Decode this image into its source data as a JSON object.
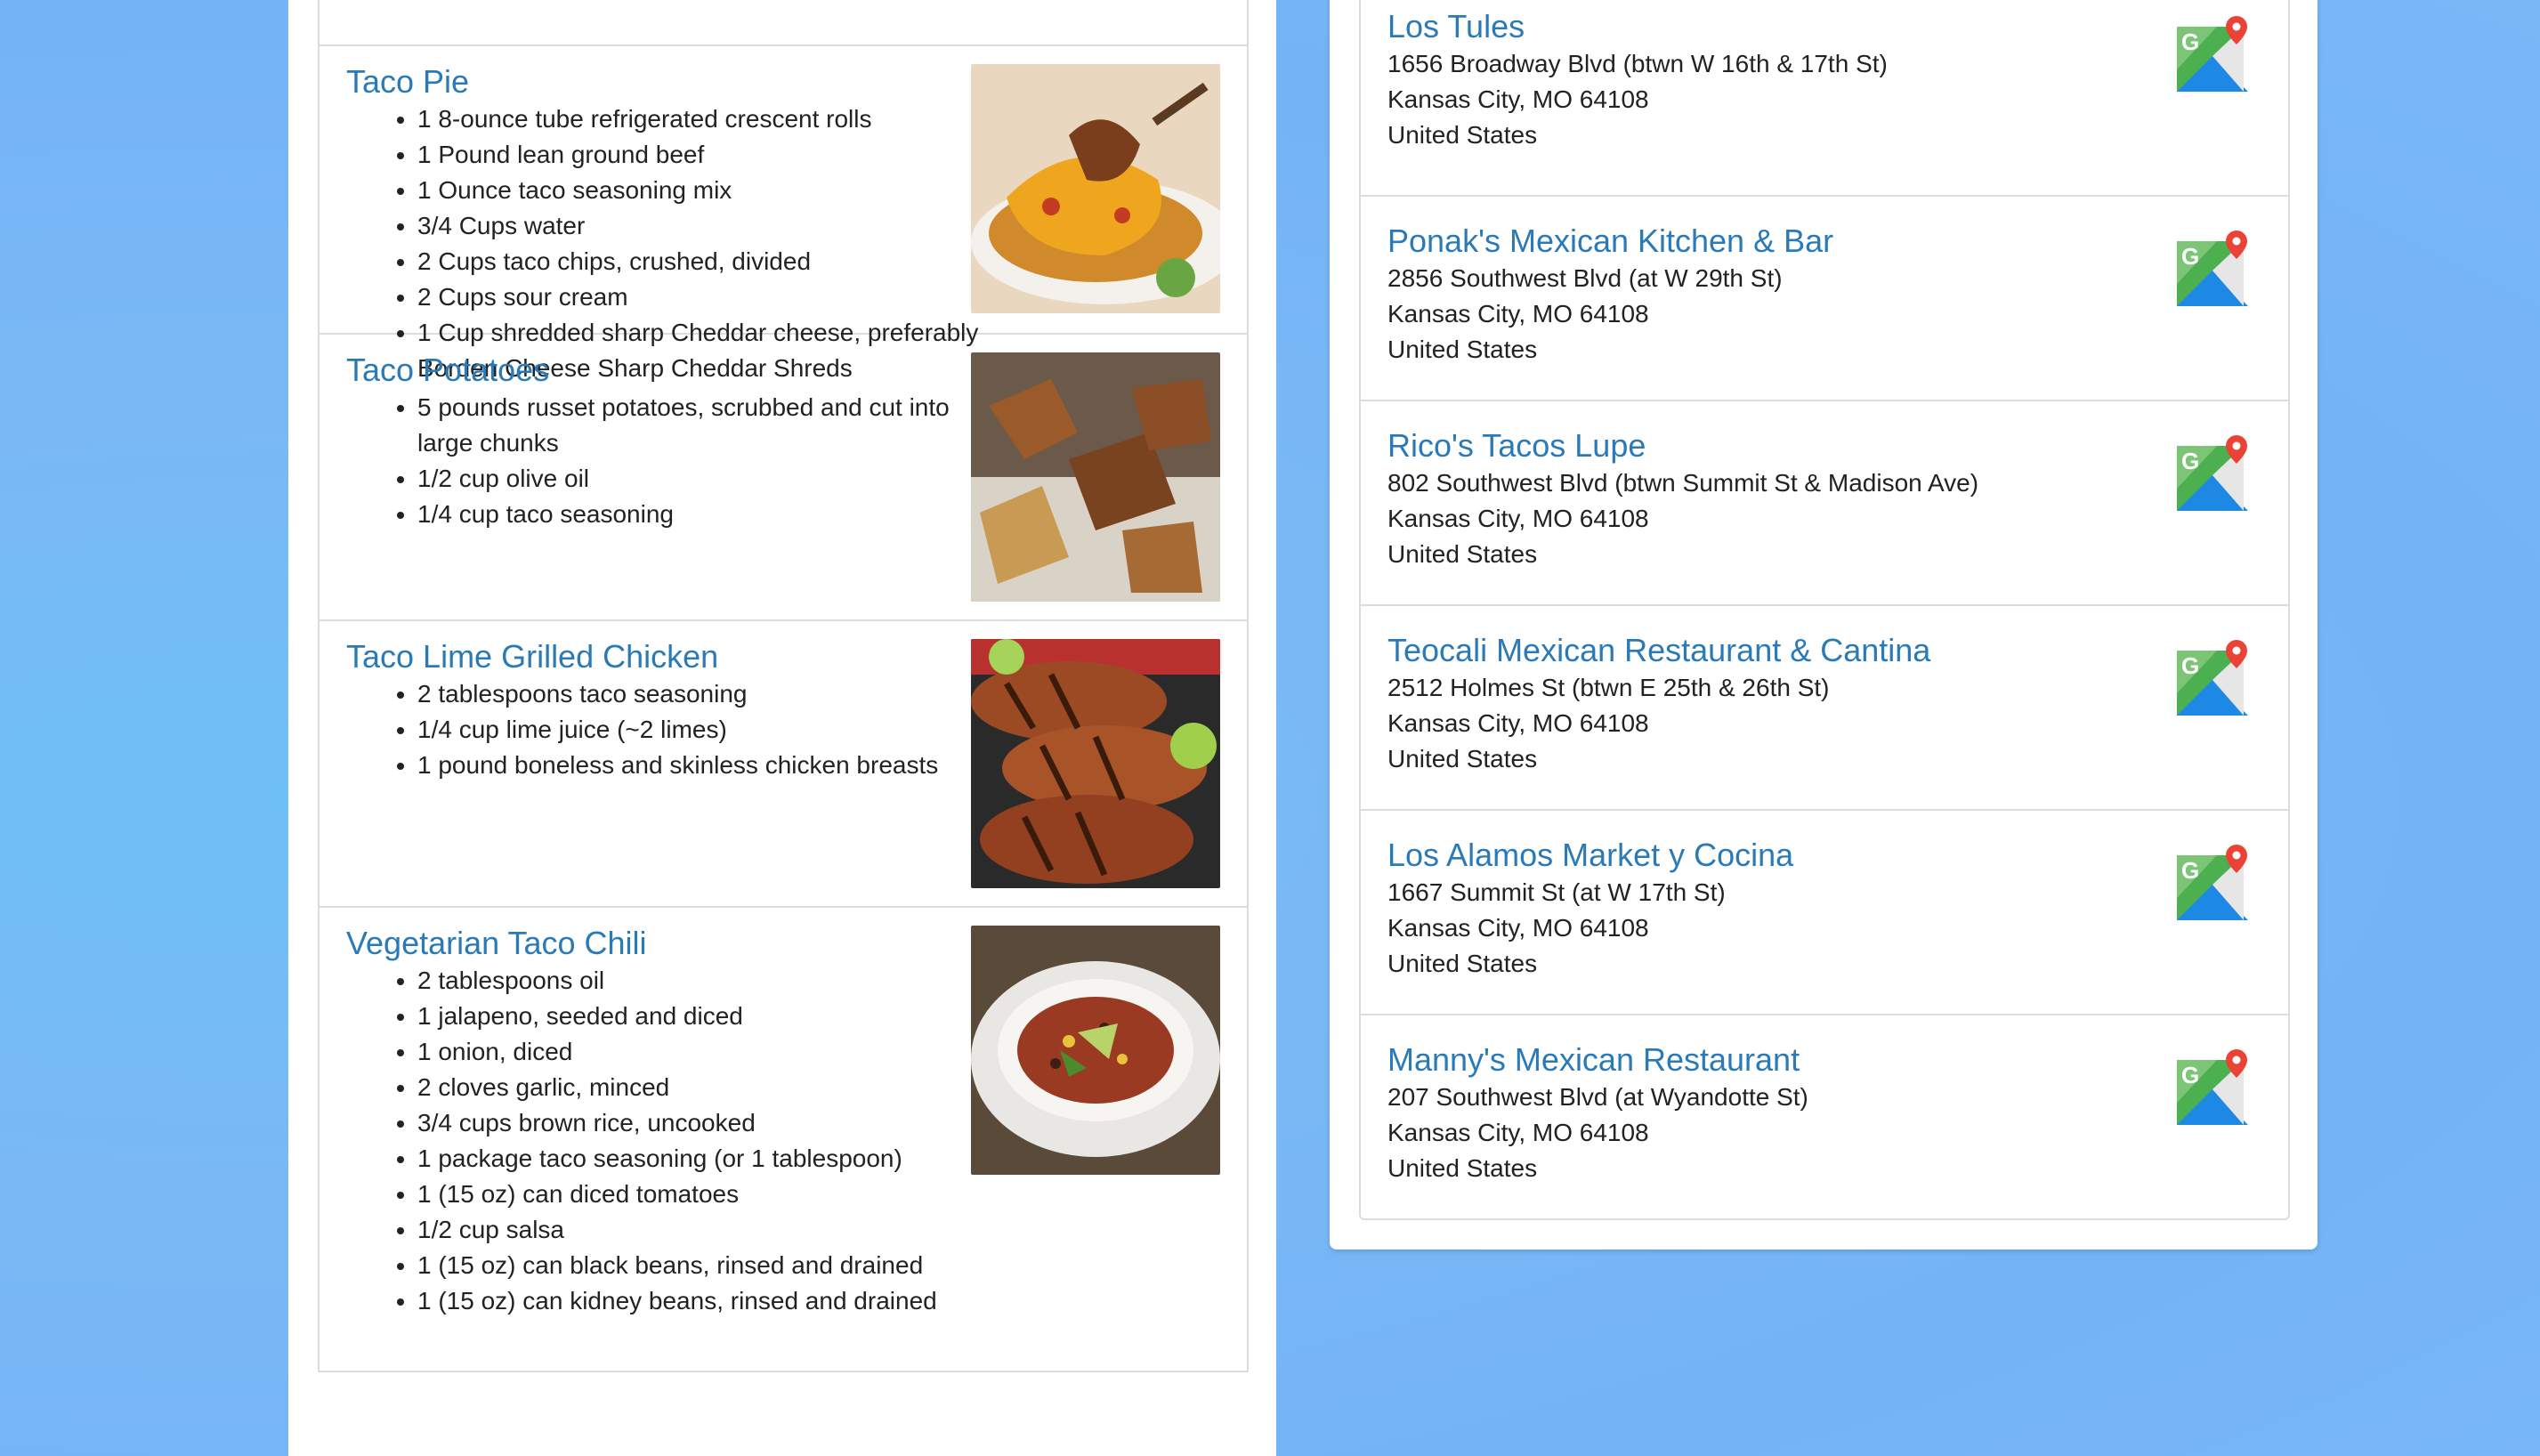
{
  "recipes": {
    "top_stub_text": "",
    "items": [
      {
        "title": "Taco Pie",
        "image_name": "taco-pie-photo",
        "ingredients": [
          "1 8-ounce tube refrigerated crescent rolls",
          "1 Pound lean ground beef",
          "1 Ounce taco seasoning mix",
          "3/4 Cups water",
          "2 Cups taco chips, crushed, divided",
          "2 Cups sour cream",
          "1 Cup shredded sharp Cheddar cheese, preferably Borden Cheese Sharp Cheddar Shreds"
        ]
      },
      {
        "title": "Taco Potatoes",
        "image_name": "taco-potatoes-photo",
        "ingredients": [
          "5 pounds russet potatoes, scrubbed and cut into large chunks",
          "1/2 cup olive oil",
          "1/4 cup taco seasoning"
        ]
      },
      {
        "title": "Taco Lime Grilled Chicken",
        "image_name": "grilled-chicken-photo",
        "ingredients": [
          "2 tablespoons taco seasoning",
          "1/4 cup lime juice (~2 limes)",
          "1 pound boneless and skinless chicken breasts"
        ]
      },
      {
        "title": "Vegetarian Taco Chili",
        "image_name": "taco-chili-photo",
        "ingredients": [
          "2 tablespoons oil",
          "1 jalapeno, seeded and diced",
          "1 onion, diced",
          "2 cloves garlic, minced",
          "3/4 cups brown rice, uncooked",
          "1 package taco seasoning (or 1 tablespoon)",
          "1 (15 oz) can diced tomatoes",
          "1/2 cup salsa",
          "1 (15 oz) can black beans, rinsed and drained",
          "1 (15 oz) can kidney beans, rinsed and drained"
        ]
      }
    ]
  },
  "restaurants": {
    "map_icon": "google-maps-icon",
    "items": [
      {
        "name": "Los Tules",
        "street": "1656 Broadway Blvd (btwn W 16th & 17th St)",
        "city": "Kansas City, MO 64108",
        "country": "United States"
      },
      {
        "name": "Ponak's Mexican Kitchen & Bar",
        "street": "2856 Southwest Blvd (at W 29th St)",
        "city": "Kansas City, MO 64108",
        "country": "United States"
      },
      {
        "name": "Rico's Tacos Lupe",
        "street": "802 Southwest Blvd (btwn Summit St & Madison Ave)",
        "city": "Kansas City, MO 64108",
        "country": "United States"
      },
      {
        "name": "Teocali Mexican Restaurant & Cantina",
        "street": "2512 Holmes St (btwn E 25th & 26th St)",
        "city": "Kansas City, MO 64108",
        "country": "United States"
      },
      {
        "name": "Los Alamos Market y Cocina",
        "street": "1667 Summit St (at W 17th St)",
        "city": "Kansas City, MO 64108",
        "country": "United States"
      },
      {
        "name": "Manny's Mexican Restaurant",
        "street": "207 Southwest Blvd (at Wyandotte St)",
        "city": "Kansas City, MO 64108",
        "country": "United States"
      }
    ]
  }
}
